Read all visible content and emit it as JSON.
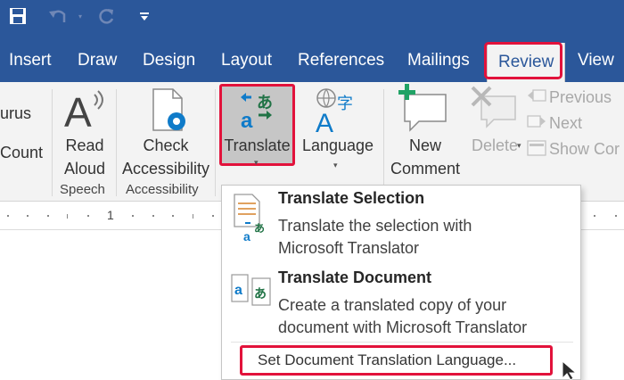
{
  "colors": {
    "ribbon_blue": "#2b579a",
    "highlight_red": "#e2123b",
    "translate_green": "#217346",
    "arrow_blue": "#0f7bc9"
  },
  "quick_access": {
    "icons": [
      "save-icon",
      "undo-icon",
      "redo-icon",
      "customize-qat-icon"
    ]
  },
  "tabs": [
    {
      "label": "Insert"
    },
    {
      "label": "Draw"
    },
    {
      "label": "Design"
    },
    {
      "label": "Layout"
    },
    {
      "label": "References"
    },
    {
      "label": "Mailings"
    },
    {
      "label": "Review"
    },
    {
      "label": "View"
    }
  ],
  "ribbon": {
    "proofing": {
      "thesaurus_partial": "urus",
      "word_count_partial": "Count"
    },
    "speech": {
      "read_aloud_line1": "Read",
      "read_aloud_line2": "Aloud",
      "group_label": "Speech"
    },
    "accessibility": {
      "check_line1": "Check",
      "check_line2": "Accessibility",
      "group_label": "Accessibility"
    },
    "language": {
      "translate_label": "Translate",
      "language_label": "Language"
    },
    "comments": {
      "new_comment_line1": "New",
      "new_comment_line2": "Comment",
      "delete_label": "Delete",
      "previous_label": "Previous",
      "next_label": "Next",
      "show_comments_partial": "Show Cor"
    }
  },
  "ruler": {
    "mark": "1"
  },
  "translate_menu": {
    "selection": {
      "title": "Translate Selection",
      "desc_line1": "Translate the selection with",
      "desc_line2": "Microsoft Translator"
    },
    "document": {
      "title": "Translate Document",
      "desc_line1": "Create a translated copy of your",
      "desc_line2": "document with Microsoft Translator"
    },
    "set_language": "Set Document Translation Language..."
  }
}
